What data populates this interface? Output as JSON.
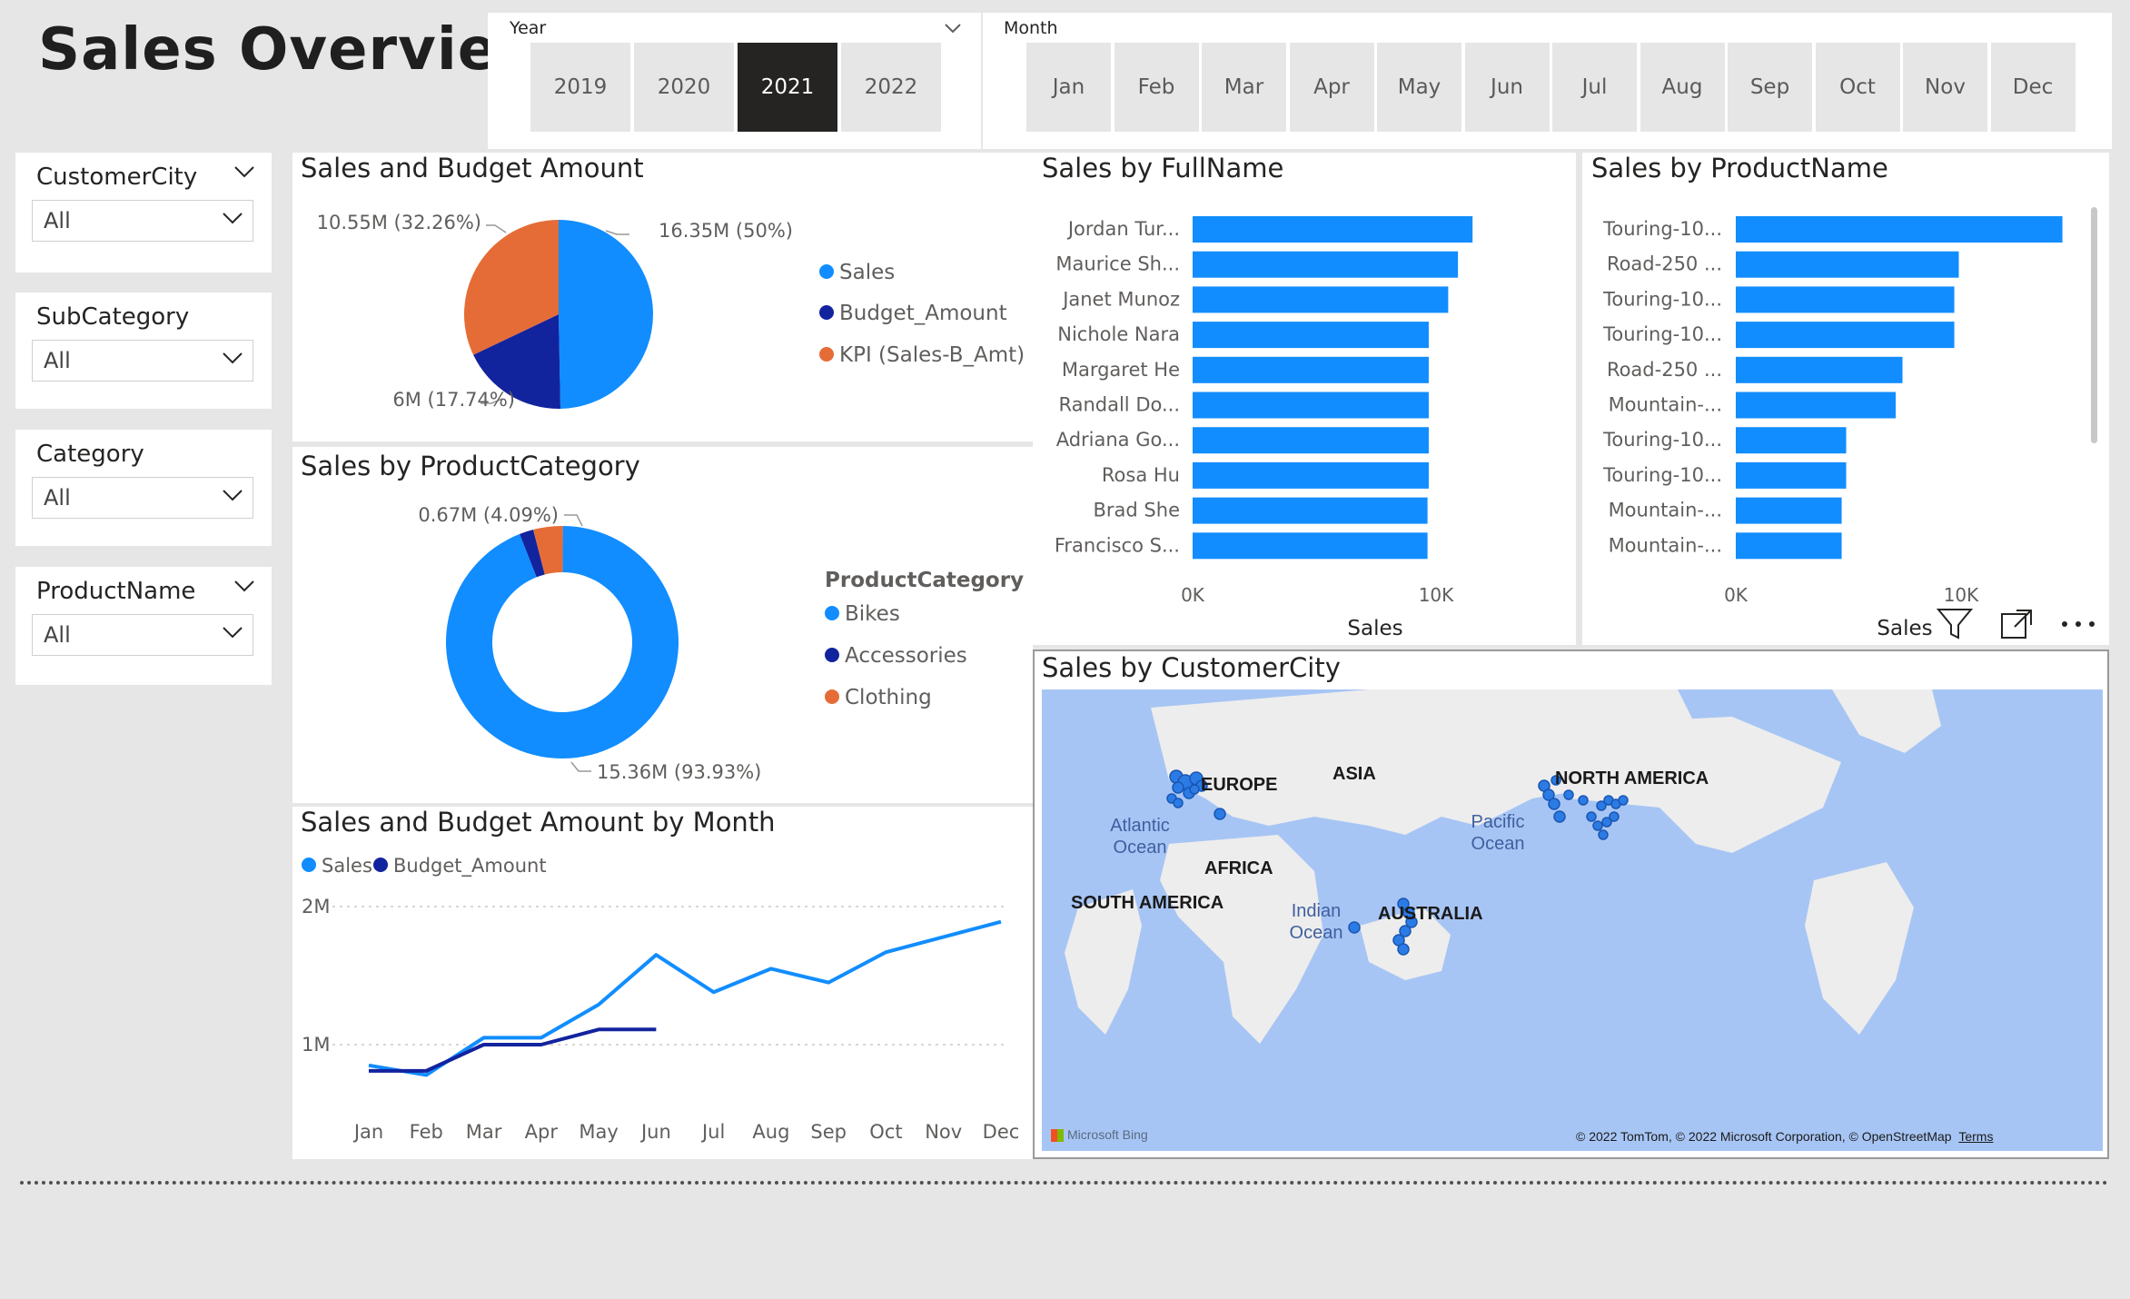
{
  "page_title": "Sales Overview",
  "year_slicer": {
    "label": "Year",
    "options": [
      "2019",
      "2020",
      "2021",
      "2022"
    ],
    "selected": "2021"
  },
  "month_slicer": {
    "label": "Month",
    "options": [
      "Jan",
      "Feb",
      "Mar",
      "Apr",
      "May",
      "Jun",
      "Jul",
      "Aug",
      "Sep",
      "Oct",
      "Nov",
      "Dec"
    ]
  },
  "filters": [
    {
      "title": "CustomerCity",
      "value": "All"
    },
    {
      "title": "SubCategory",
      "value": "All"
    },
    {
      "title": "Category",
      "value": "All"
    },
    {
      "title": "ProductName",
      "value": "All"
    }
  ],
  "colors": {
    "sales": "#118dff",
    "budget": "#12239e",
    "kpi": "#e66c37",
    "selected": "#252423"
  },
  "visuals": {
    "pie_title": "Sales and Budget Amount",
    "donut_title": "Sales by ProductCategory",
    "fullname_title": "Sales by FullName",
    "productname_title": "Sales by ProductName",
    "line_title": "Sales and Budget Amount by Month",
    "map_title": "Sales by CustomerCity"
  },
  "chart_data": [
    {
      "type": "pie",
      "title": "Sales and Budget Amount",
      "series": [
        {
          "name": "Sales",
          "value": 16.35,
          "label": "16.35M (50%)"
        },
        {
          "name": "Budget_Amount",
          "value": 6,
          "label": "6M (17.74%)"
        },
        {
          "name": "KPI (Sales-B_Amt)",
          "value": 10.55,
          "label": "10.55M (32.26%)"
        }
      ]
    },
    {
      "type": "pie",
      "title": "Sales by ProductCategory",
      "legend_title": "ProductCategory",
      "series": [
        {
          "name": "Bikes",
          "value": 15.36,
          "label": "15.36M (93.93%)"
        },
        {
          "name": "Accessories",
          "value": 0.32,
          "label": ""
        },
        {
          "name": "Clothing",
          "value": 0.67,
          "label": "0.67M (4.09%)"
        }
      ]
    },
    {
      "type": "bar",
      "title": "Sales by FullName",
      "xlabel": "Sales",
      "categories": [
        "Jordan Tur...",
        "Maurice Sh...",
        "Janet Munoz",
        "Nichole Nara",
        "Margaret He",
        "Randall Do...",
        "Adriana Go...",
        "Rosa Hu",
        "Brad She",
        "Francisco S..."
      ],
      "values": [
        11500,
        10900,
        10500,
        9700,
        9700,
        9700,
        9700,
        9700,
        9650,
        9650
      ],
      "xticks": [
        "0K",
        "10K"
      ],
      "xlim": [
        0,
        10000
      ]
    },
    {
      "type": "bar",
      "title": "Sales by ProductName",
      "xlabel": "Sales",
      "categories": [
        "Touring-10...",
        "Road-250 ...",
        "Touring-10...",
        "Touring-10...",
        "Road-250 ...",
        "Mountain-...",
        "Touring-10...",
        "Touring-10...",
        "Mountain-...",
        "Mountain-..."
      ],
      "values": [
        14500,
        9900,
        9700,
        9700,
        7400,
        7100,
        4900,
        4900,
        4700,
        4700
      ],
      "xticks": [
        "0K",
        "10K"
      ],
      "xlim": [
        0,
        10000
      ]
    },
    {
      "type": "line",
      "title": "Sales and Budget Amount by Month",
      "categories": [
        "Jan",
        "Feb",
        "Mar",
        "Apr",
        "May",
        "Jun",
        "Jul",
        "Aug",
        "Sep",
        "Oct",
        "Nov",
        "Dec"
      ],
      "yticks": [
        "1M",
        "2M"
      ],
      "ylim": [
        0,
        2000000
      ],
      "series": [
        {
          "name": "Sales",
          "values": [
            850000,
            780000,
            1050000,
            1050000,
            1290000,
            1650000,
            1380000,
            1550000,
            1450000,
            1670000,
            1780000,
            1890000
          ]
        },
        {
          "name": "Budget_Amount",
          "values": [
            810000,
            810000,
            1000000,
            1000000,
            1110000,
            1110000,
            null,
            null,
            null,
            null,
            null,
            null
          ]
        }
      ]
    }
  ],
  "map": {
    "labels": {
      "europe": "EUROPE",
      "asia": "ASIA",
      "africa": "AFRICA",
      "south_america": "SOUTH AMERICA",
      "north_america": "NORTH AMERICA",
      "australia": "AUSTRALIA"
    },
    "oceans": {
      "atlantic": "Atlantic Ocean",
      "pacific": "Pacific Ocean",
      "indian": "Indian Ocean"
    },
    "attribution": "© 2022 TomTom, © 2022 Microsoft Corporation, © OpenStreetMap",
    "terms": "Terms",
    "brand": "Microsoft Bing"
  },
  "visual_header_icons": [
    "filter-icon",
    "focus-mode-icon",
    "more-options-icon"
  ]
}
